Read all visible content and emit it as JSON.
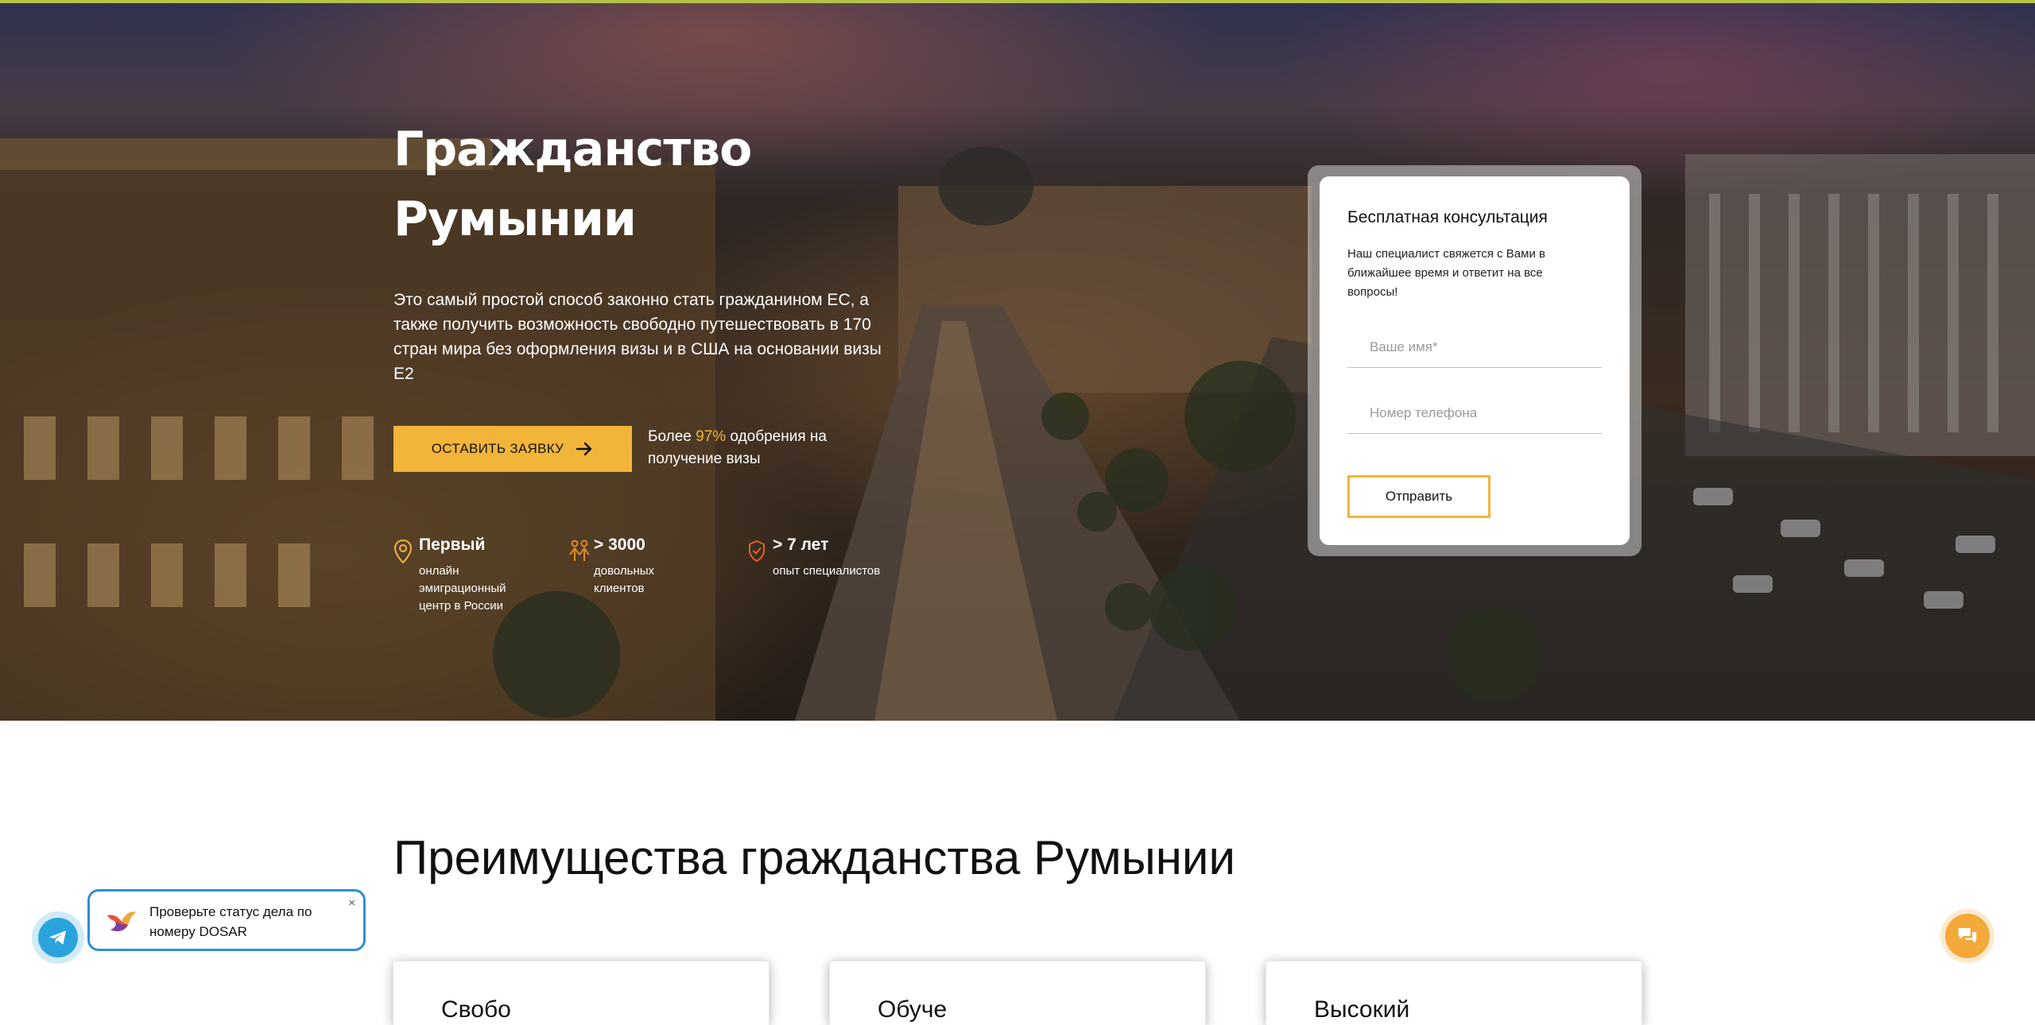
{
  "hero": {
    "title_line1": "Гражданство",
    "title_line2": "Румынии",
    "description": "Это самый простой способ законно стать гражданином ЕС, а также получить возможность свободно путешествовать в 170 стран мира без оформления визы и в США на основании визы Е2",
    "cta_label": "ОСТАВИТЬ ЗАЯВКУ",
    "approval_prefix": "Более ",
    "approval_highlight": "97%",
    "approval_suffix": " одобрения на получение визы",
    "stats": [
      {
        "value": "Первый",
        "caption": "онлайн эмиграционный центр в России",
        "icon": "location-pin-icon"
      },
      {
        "value": "> 3000",
        "caption": "довольных клиентов",
        "icon": "happy-people-icon"
      },
      {
        "value": "> 7 лет",
        "caption": "опыт специалистов",
        "icon": "shield-check-icon"
      }
    ]
  },
  "form": {
    "title": "Бесплатная консультация",
    "subtitle": "Наш специалист свяжется с Вами в ближайшее время и ответит на все вопросы!",
    "name_placeholder": "Ваше имя*",
    "phone_placeholder": "Номер телефона",
    "submit_label": "Отправить"
  },
  "advantages": {
    "title": "Преимущества гражданства Румынии",
    "cards": [
      {
        "title": "Свобо"
      },
      {
        "title": "Обуче"
      },
      {
        "title": "Высокий"
      }
    ]
  },
  "widgets": {
    "notification_text": "Проверьте статус дела по номеру DOSAR",
    "close_symbol": "×",
    "telegram_icon": "telegram-icon",
    "chat_icon": "chat-icon"
  },
  "colors": {
    "accent": "#f2b53a",
    "telegram": "#2aa3dc",
    "chat": "#f2a93a",
    "top_bar": "#b5c24a"
  }
}
